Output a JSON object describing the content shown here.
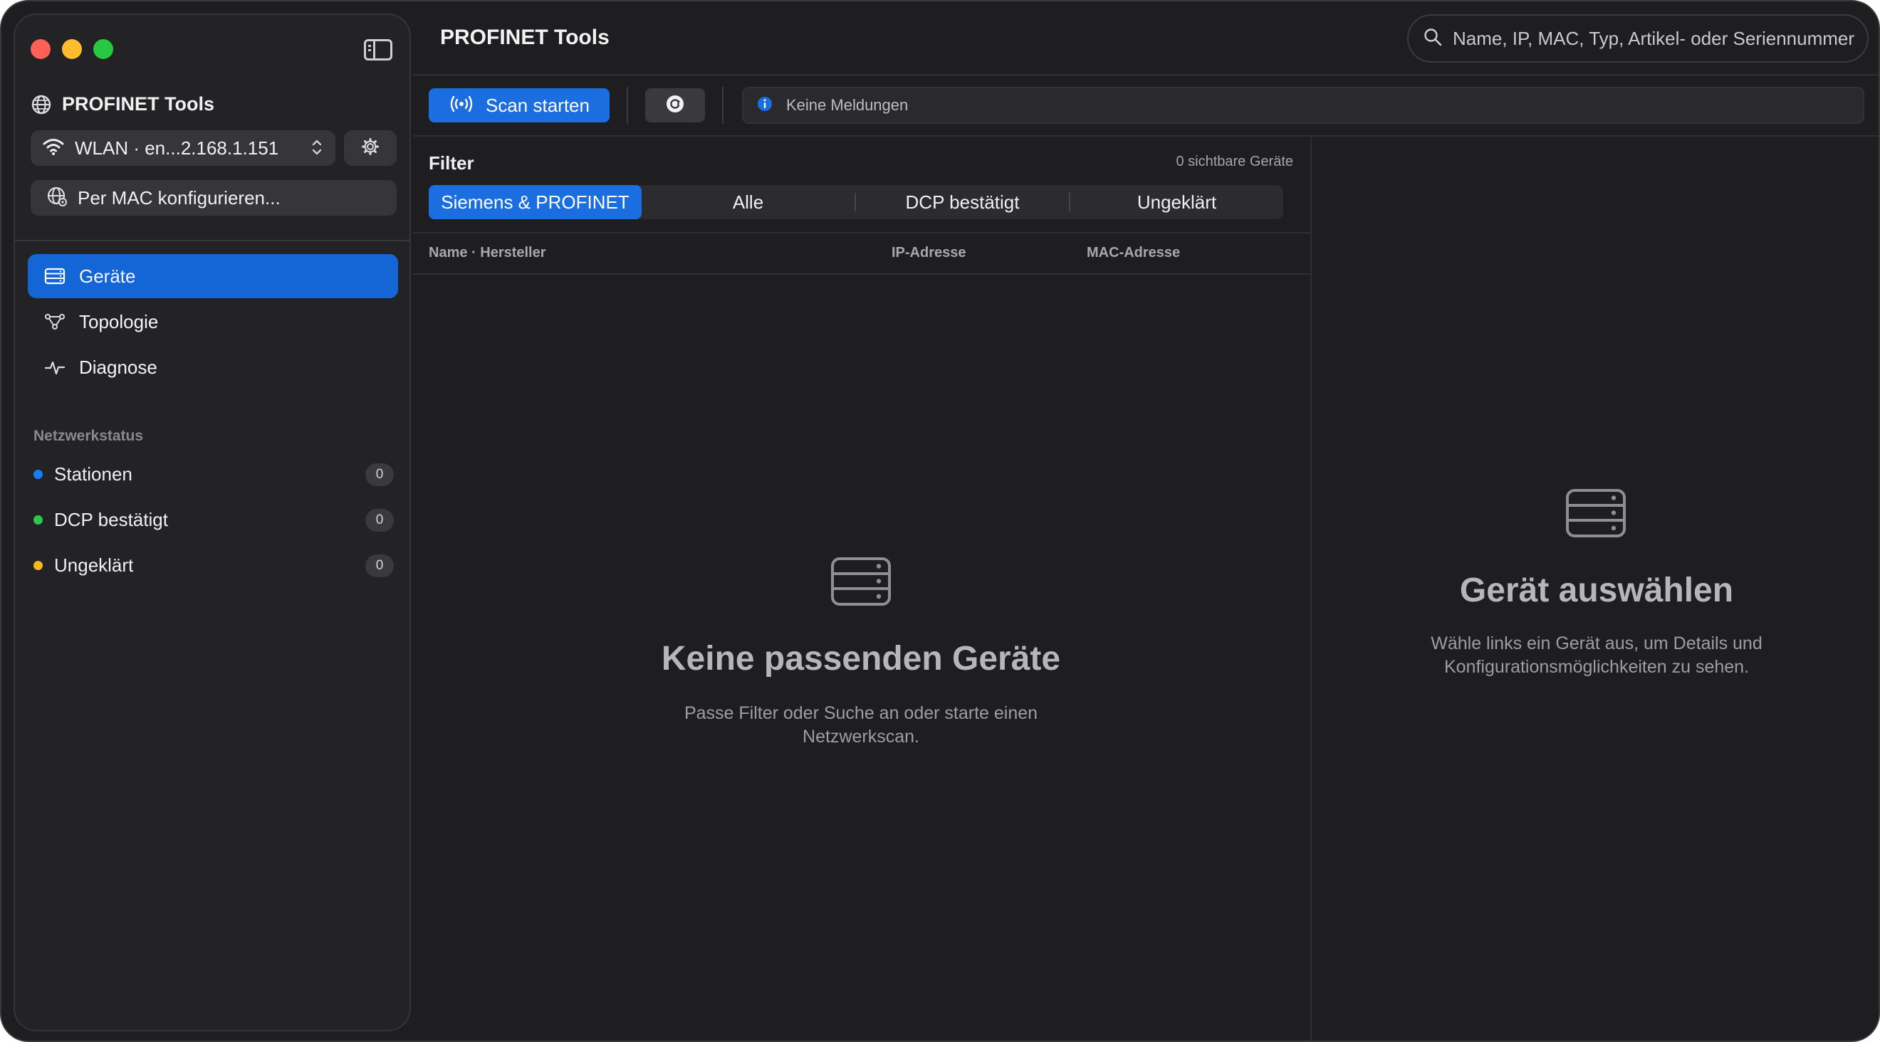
{
  "sidebar": {
    "app_title": "PROFINET Tools",
    "interface": "WLAN · en...2.168.1.151",
    "mac_config_label": "Per MAC konfigurieren...",
    "nav": [
      {
        "label": "Geräte",
        "icon": "devices-icon"
      },
      {
        "label": "Topologie",
        "icon": "topology-icon"
      },
      {
        "label": "Diagnose",
        "icon": "diagnose-icon"
      }
    ],
    "network_status_title": "Netzwerkstatus",
    "status_items": [
      {
        "label": "Stationen",
        "count": "0",
        "color": "#1a7cf5"
      },
      {
        "label": "DCP bestätigt",
        "count": "0",
        "color": "#31c552"
      },
      {
        "label": "Ungeklärt",
        "count": "0",
        "color": "#f5b91c"
      }
    ]
  },
  "header": {
    "title": "PROFINET Tools",
    "search_placeholder": "Name, IP, MAC, Typ, Artikel- oder Seriennummer"
  },
  "toolbar": {
    "scan_label": "Scan starten",
    "message": "Keine Meldungen"
  },
  "filter": {
    "title": "Filter",
    "visible_count": "0 sichtbare Geräte",
    "segments": [
      "Siemens & PROFINET",
      "Alle",
      "DCP bestätigt",
      "Ungeklärt"
    ],
    "selected": "Siemens & PROFINET"
  },
  "table": {
    "columns": [
      "Name · Hersteller",
      "IP-Adresse",
      "MAC-Adresse"
    ]
  },
  "empty_list": {
    "title": "Keine passenden Geräte",
    "text": "Passe Filter oder Suche an oder starte einen Netzwerkscan."
  },
  "detail": {
    "title": "Gerät auswählen",
    "text": "Wähle links ein Gerät aus, um Details und Konfigurationsmöglichkeiten zu sehen."
  },
  "colors": {
    "accent": "#1a6ee0",
    "sidebar_active": "#1465d6",
    "background": "#1e1e20"
  }
}
